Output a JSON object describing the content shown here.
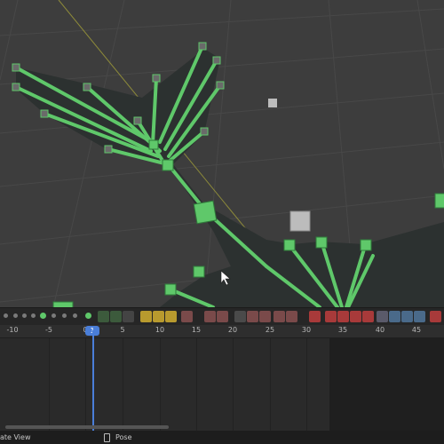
{
  "timeline": {
    "ticks": [
      "-10",
      "-5",
      "0",
      "5",
      "10",
      "15",
      "20",
      "25",
      "30",
      "35",
      "40",
      "45"
    ],
    "current_frame": "1"
  },
  "status_bar": {
    "left_text": "ate View",
    "mode_label": "Pose"
  },
  "colors": {
    "bone_green": "#5fc86a",
    "bone_green_dark": "#2f7a3a",
    "viewport_bg": "#3d3d3d",
    "grid_line": "#4a4a4a",
    "playhead_blue": "#4a7ed8",
    "mesh_dark": "#2c3130"
  },
  "icons": {
    "cursor": "mouse-pointer-icon",
    "toolbar": [
      "keyframe-icon",
      "interpolation-icon",
      "handle-icon",
      "copy-icon",
      "paste-icon",
      "delete-icon"
    ]
  }
}
